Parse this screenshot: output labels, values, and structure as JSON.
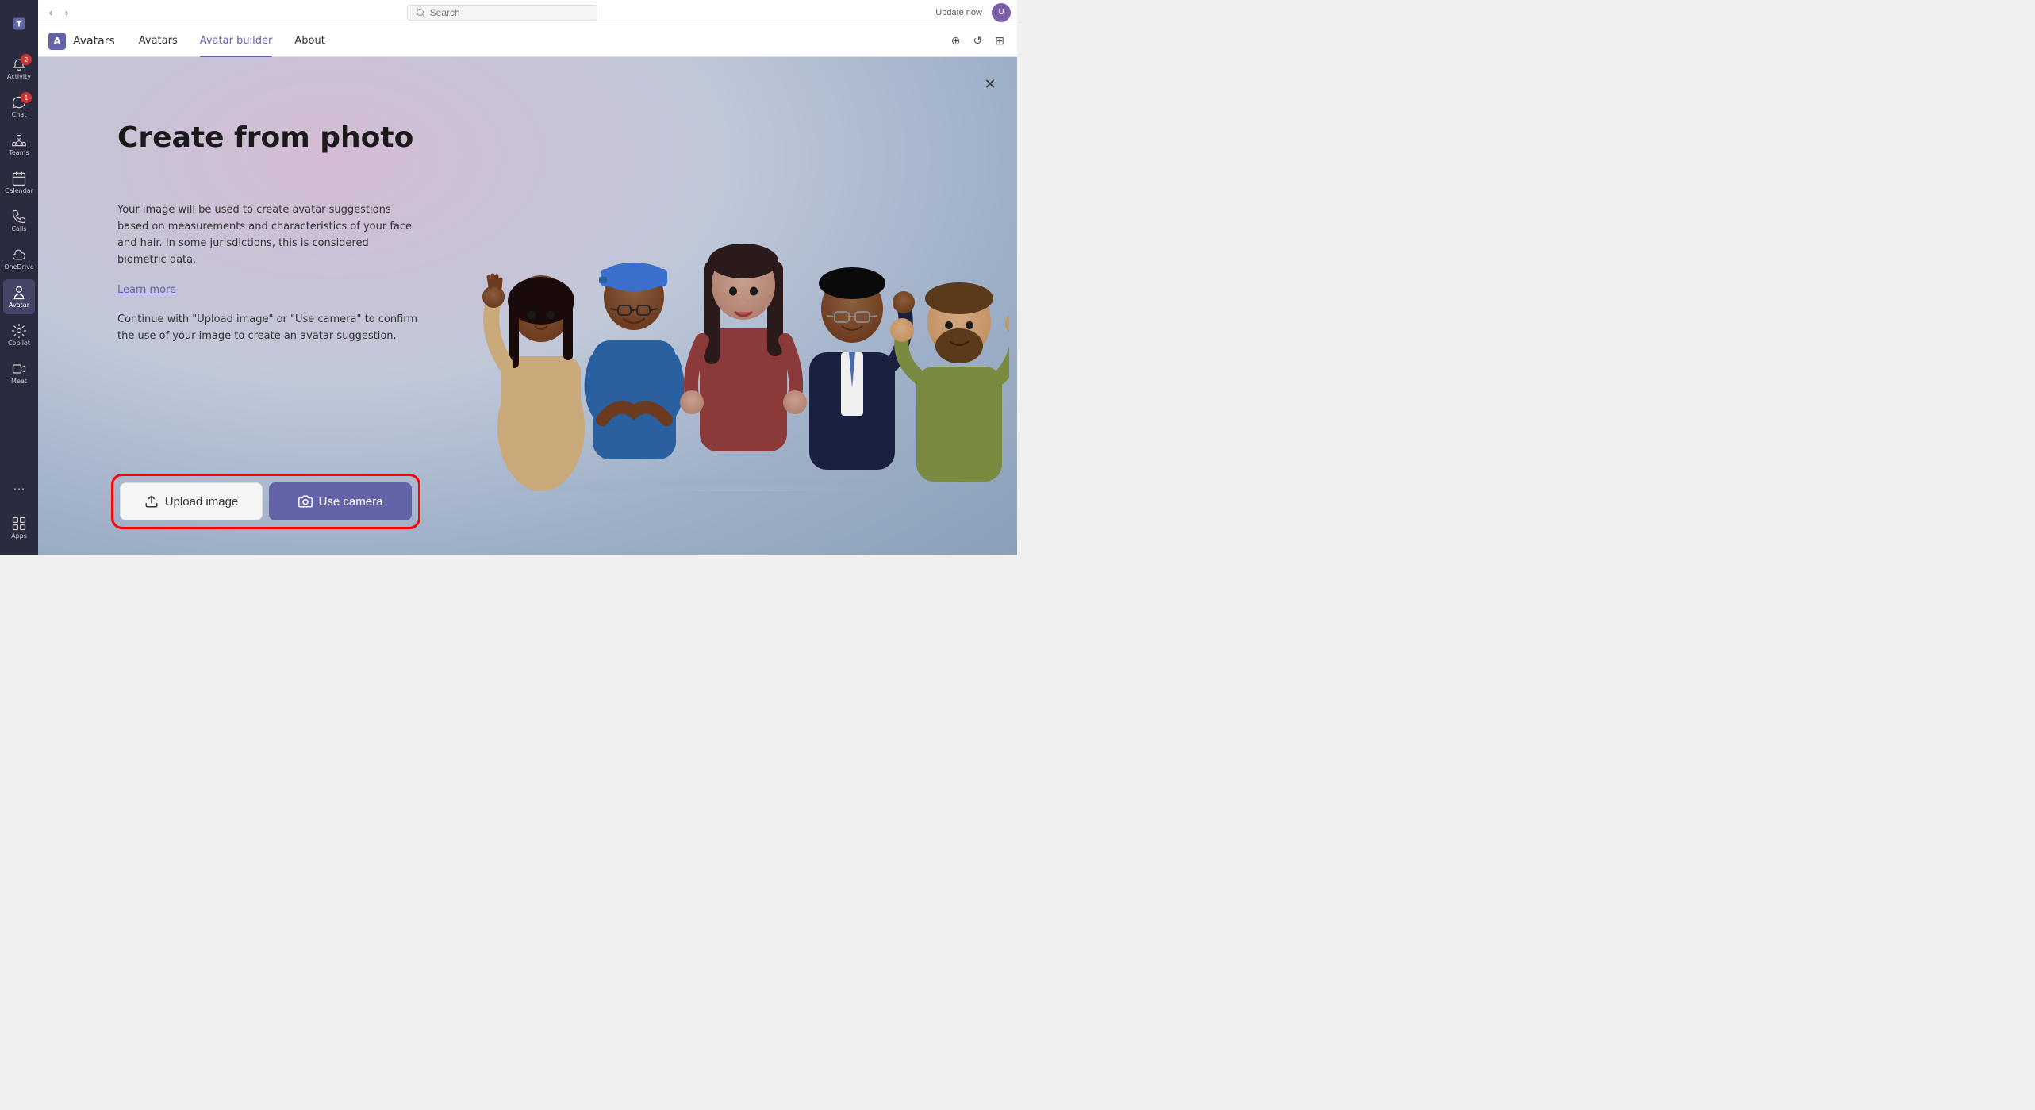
{
  "sidebar": {
    "items": [
      {
        "id": "activity",
        "label": "Activity",
        "icon": "bell",
        "active": false,
        "badge": "2"
      },
      {
        "id": "chat",
        "label": "Chat",
        "icon": "chat",
        "active": false,
        "badge": "1"
      },
      {
        "id": "teams",
        "label": "Teams",
        "icon": "teams",
        "active": false
      },
      {
        "id": "calendar",
        "label": "Calendar",
        "icon": "calendar",
        "active": false
      },
      {
        "id": "calls",
        "label": "Calls",
        "icon": "phone",
        "active": false
      },
      {
        "id": "onedrive",
        "label": "OneDrive",
        "icon": "cloud",
        "active": false
      },
      {
        "id": "avatar",
        "label": "Avatar",
        "icon": "person",
        "active": true
      },
      {
        "id": "copilot",
        "label": "Copilot",
        "icon": "copilot",
        "active": false
      },
      {
        "id": "meet",
        "label": "Meet",
        "icon": "video",
        "active": false
      },
      {
        "id": "apps",
        "label": "Apps",
        "icon": "apps",
        "active": false
      }
    ]
  },
  "topbar": {
    "back_label": "‹",
    "forward_label": "›",
    "search_placeholder": "Search",
    "update_label": "Update now",
    "settings_icons": [
      "⊕",
      "↺",
      "⊞"
    ]
  },
  "app_tabs": {
    "app_name": "Avatars",
    "tabs": [
      {
        "id": "avatars",
        "label": "Avatars",
        "active": false
      },
      {
        "id": "avatar-builder",
        "label": "Avatar builder",
        "active": true
      },
      {
        "id": "about",
        "label": "About",
        "active": false
      }
    ]
  },
  "content": {
    "title": "Create from photo",
    "description": "Your image will be used to create avatar suggestions based on measurements and characteristics of your face and hair. In some jurisdictions, this is considered biometric data.",
    "learn_more": "Learn more",
    "consent_text": "Continue with \"Upload image\" or \"Use camera\" to confirm the use of your image to create an avatar suggestion."
  },
  "buttons": {
    "upload_label": "Upload image",
    "camera_label": "Use camera",
    "close_label": "✕"
  },
  "colors": {
    "accent": "#6264a7",
    "camera_bg": "#7264a7",
    "highlight_border": "#ff0000"
  }
}
